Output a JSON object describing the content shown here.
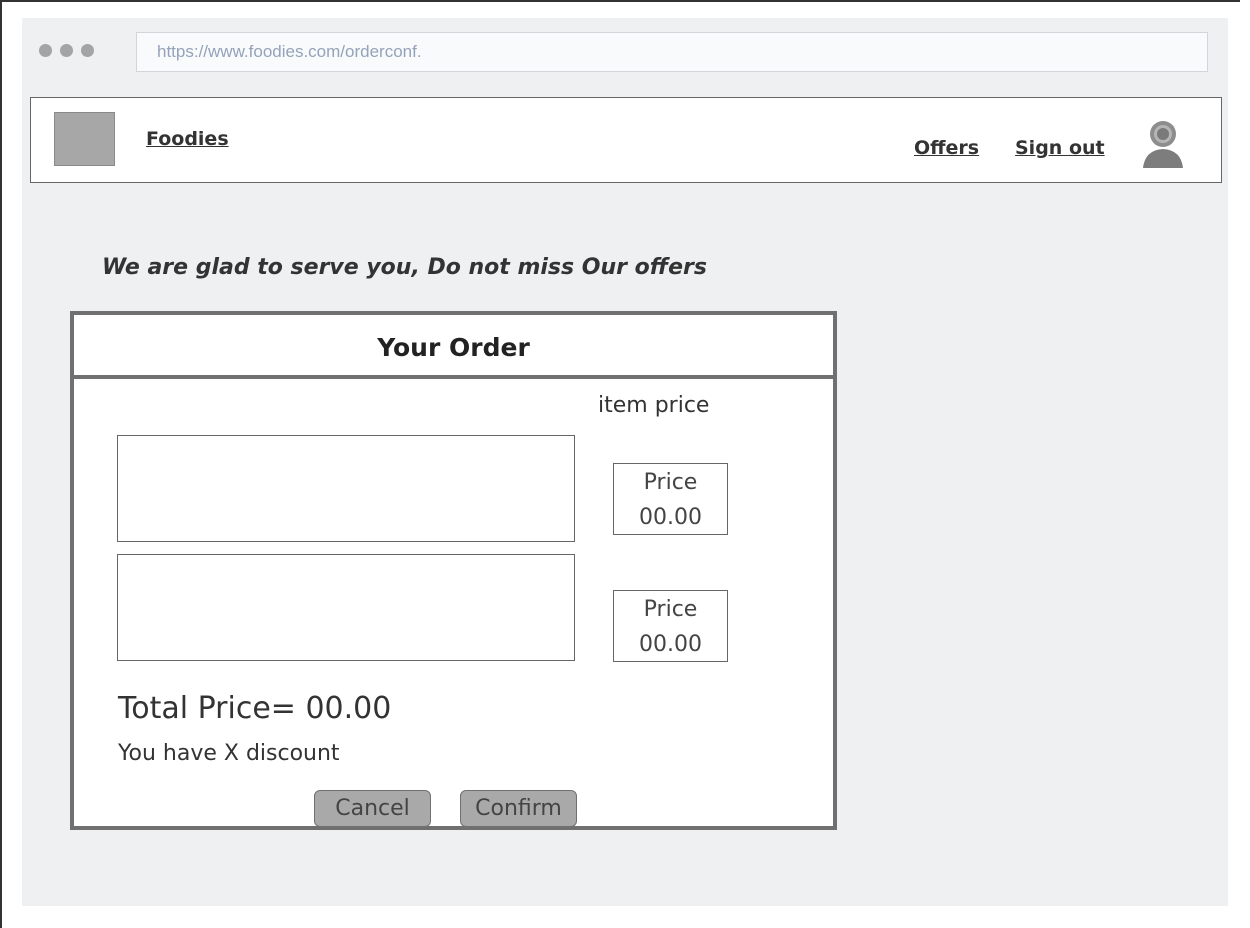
{
  "browser": {
    "url": "https://www.foodies.com/orderconf."
  },
  "navbar": {
    "brand": "Foodies",
    "links": [
      "Offers",
      "Sign out"
    ],
    "avatar_icon": "user-avatar-icon"
  },
  "tagline": "We are glad to serve you, Do not miss Our offers",
  "order": {
    "title": "Your Order",
    "price_column_label": "item price",
    "items": [
      {
        "price_label": "Price",
        "price_value": "00.00"
      },
      {
        "price_label": "Price",
        "price_value": "00.00"
      }
    ],
    "total": "Total Price= 00.00",
    "discount": "You have X discount",
    "cancel_label": "Cancel",
    "confirm_label": "Confirm"
  },
  "colors": {
    "panel_border": "#707070",
    "button_fill": "#a9a9a9",
    "url_text": "#94a3ba"
  }
}
